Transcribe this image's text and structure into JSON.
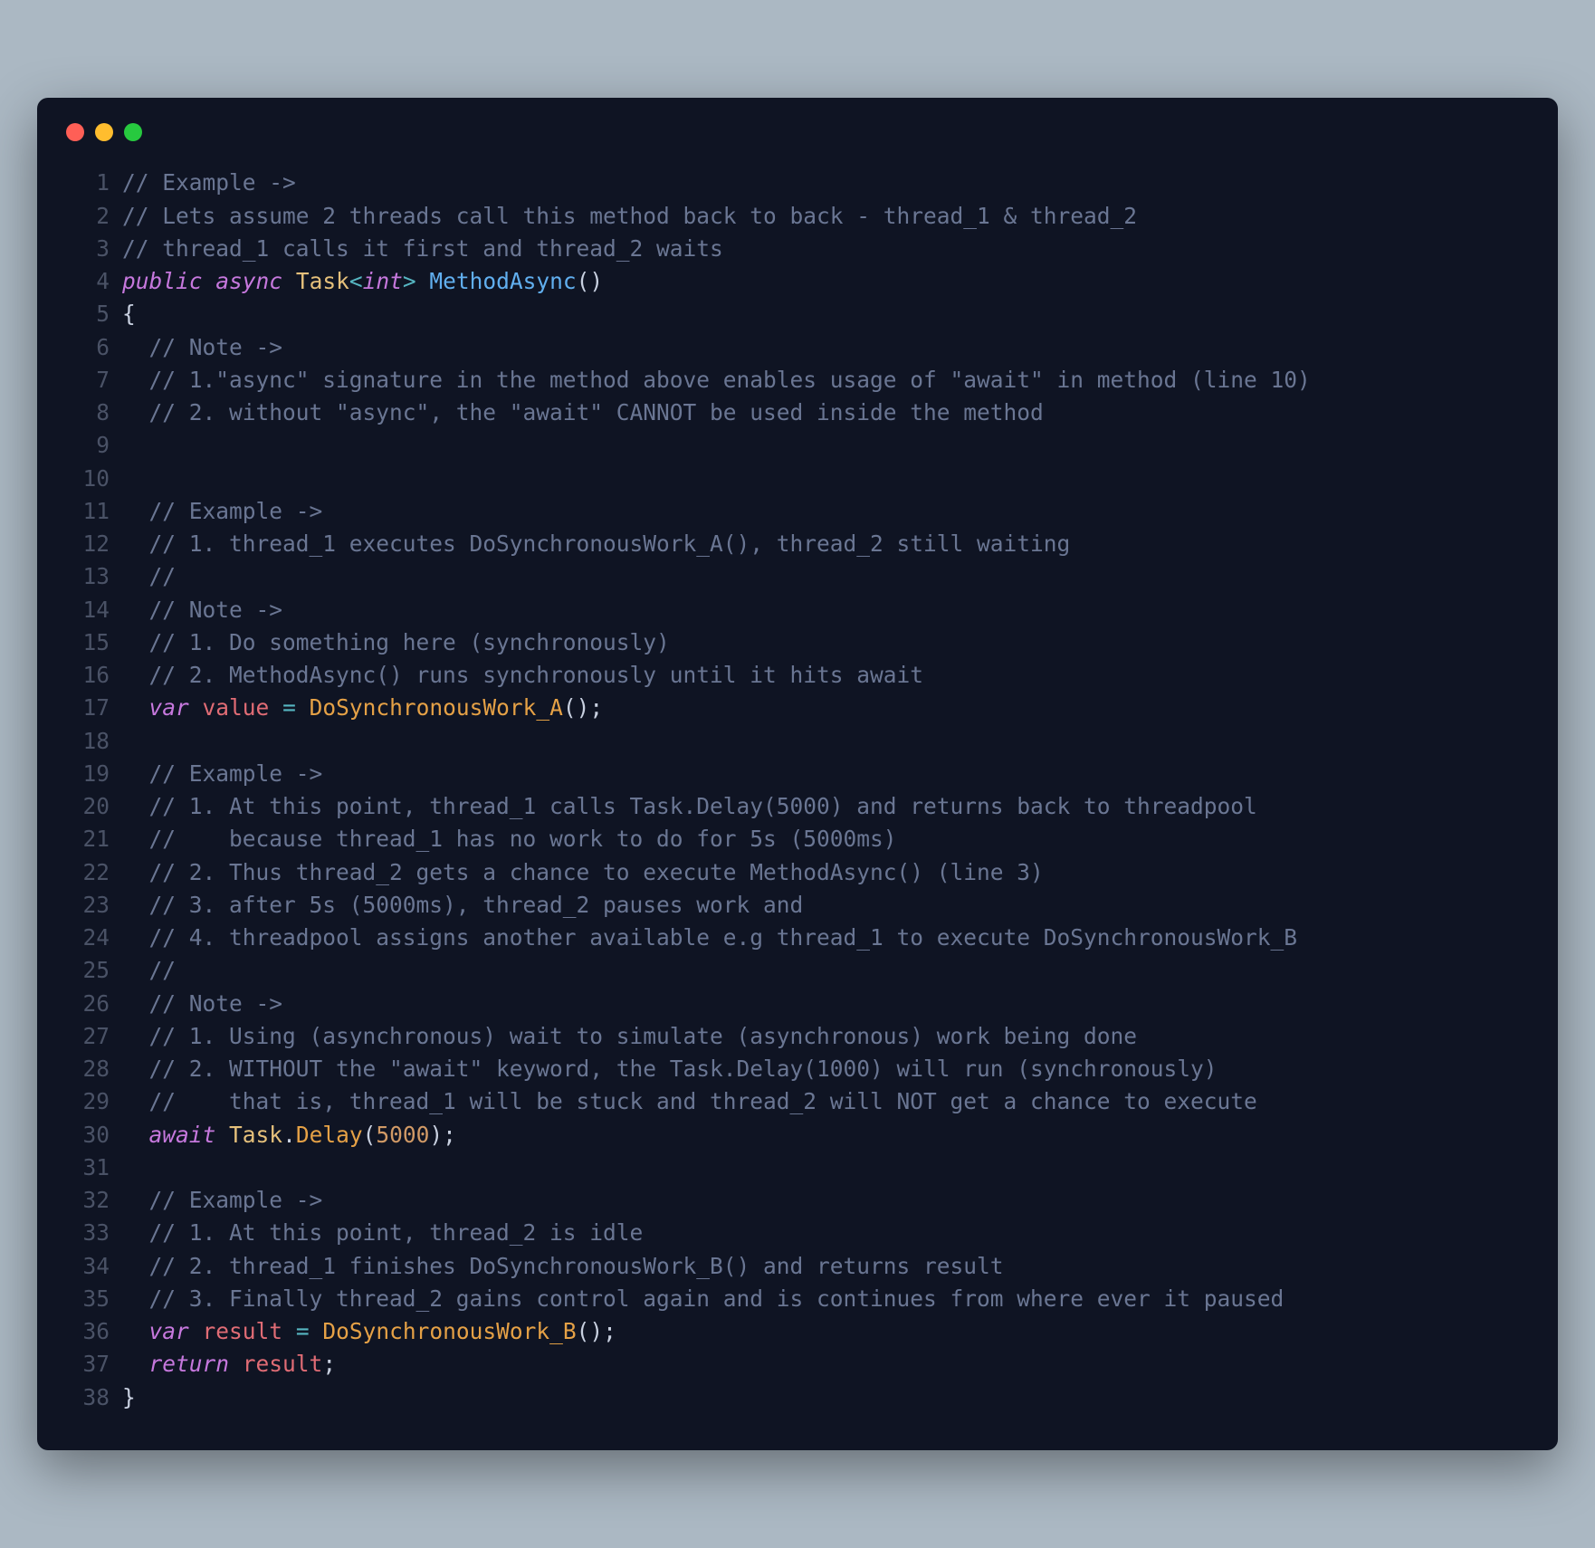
{
  "window": {
    "traffic_lights": {
      "red": "#ff5f56",
      "yellow": "#ffbd2e",
      "green": "#27c93f"
    }
  },
  "code": {
    "lines": [
      {
        "n": "1",
        "tokens": [
          [
            "comment",
            "// Example ->"
          ]
        ]
      },
      {
        "n": "2",
        "tokens": [
          [
            "comment",
            "// Lets assume 2 threads call this method back to back - thread_1 & thread_2"
          ]
        ]
      },
      {
        "n": "3",
        "tokens": [
          [
            "comment",
            "// thread_1 calls it first and thread_2 waits"
          ]
        ]
      },
      {
        "n": "4",
        "tokens": [
          [
            "keyword",
            "public"
          ],
          [
            "plain",
            " "
          ],
          [
            "keyword",
            "async"
          ],
          [
            "plain",
            " "
          ],
          [
            "class",
            "Task"
          ],
          [
            "op",
            "<"
          ],
          [
            "keyword2",
            "int"
          ],
          [
            "op",
            ">"
          ],
          [
            "plain",
            " "
          ],
          [
            "method",
            "MethodAsync"
          ],
          [
            "punct",
            "("
          ],
          [
            "punct",
            ")"
          ]
        ]
      },
      {
        "n": "5",
        "tokens": [
          [
            "brace",
            "{"
          ]
        ]
      },
      {
        "n": "6",
        "tokens": [
          [
            "plain",
            "  "
          ],
          [
            "comment",
            "// Note ->"
          ]
        ]
      },
      {
        "n": "7",
        "tokens": [
          [
            "plain",
            "  "
          ],
          [
            "comment",
            "// 1.\"async\" signature in the method above enables usage of \"await\" in method (line 10)"
          ]
        ]
      },
      {
        "n": "8",
        "tokens": [
          [
            "plain",
            "  "
          ],
          [
            "comment",
            "// 2. without \"async\", the \"await\" CANNOT be used inside the method"
          ]
        ]
      },
      {
        "n": "9",
        "tokens": []
      },
      {
        "n": "10",
        "tokens": []
      },
      {
        "n": "11",
        "tokens": [
          [
            "plain",
            "  "
          ],
          [
            "comment",
            "// Example ->"
          ]
        ]
      },
      {
        "n": "12",
        "tokens": [
          [
            "plain",
            "  "
          ],
          [
            "comment",
            "// 1. thread_1 executes DoSynchronousWork_A(), thread_2 still waiting"
          ]
        ]
      },
      {
        "n": "13",
        "tokens": [
          [
            "plain",
            "  "
          ],
          [
            "comment",
            "//"
          ]
        ]
      },
      {
        "n": "14",
        "tokens": [
          [
            "plain",
            "  "
          ],
          [
            "comment",
            "// Note ->"
          ]
        ]
      },
      {
        "n": "15",
        "tokens": [
          [
            "plain",
            "  "
          ],
          [
            "comment",
            "// 1. Do something here (synchronously)"
          ]
        ]
      },
      {
        "n": "16",
        "tokens": [
          [
            "plain",
            "  "
          ],
          [
            "comment",
            "// 2. MethodAsync() runs synchronously until it hits await"
          ]
        ]
      },
      {
        "n": "17",
        "tokens": [
          [
            "plain",
            "  "
          ],
          [
            "var",
            "var"
          ],
          [
            "plain",
            " "
          ],
          [
            "ident",
            "value"
          ],
          [
            "plain",
            " "
          ],
          [
            "op",
            "="
          ],
          [
            "plain",
            " "
          ],
          [
            "call",
            "DoSynchronousWork_A"
          ],
          [
            "punct",
            "("
          ],
          [
            "punct",
            ")"
          ],
          [
            "punct",
            ";"
          ]
        ]
      },
      {
        "n": "18",
        "tokens": []
      },
      {
        "n": "19",
        "tokens": [
          [
            "plain",
            "  "
          ],
          [
            "comment",
            "// Example ->"
          ]
        ]
      },
      {
        "n": "20",
        "tokens": [
          [
            "plain",
            "  "
          ],
          [
            "comment",
            "// 1. At this point, thread_1 calls Task.Delay(5000) and returns back to threadpool"
          ]
        ]
      },
      {
        "n": "21",
        "tokens": [
          [
            "plain",
            "  "
          ],
          [
            "comment",
            "//    because thread_1 has no work to do for 5s (5000ms)"
          ]
        ]
      },
      {
        "n": "22",
        "tokens": [
          [
            "plain",
            "  "
          ],
          [
            "comment",
            "// 2. Thus thread_2 gets a chance to execute MethodAsync() (line 3)"
          ]
        ]
      },
      {
        "n": "23",
        "tokens": [
          [
            "plain",
            "  "
          ],
          [
            "comment",
            "// 3. after 5s (5000ms), thread_2 pauses work and"
          ]
        ]
      },
      {
        "n": "24",
        "tokens": [
          [
            "plain",
            "  "
          ],
          [
            "comment",
            "// 4. threadpool assigns another available e.g thread_1 to execute DoSynchronousWork_B"
          ]
        ]
      },
      {
        "n": "25",
        "tokens": [
          [
            "plain",
            "  "
          ],
          [
            "comment",
            "//"
          ]
        ]
      },
      {
        "n": "26",
        "tokens": [
          [
            "plain",
            "  "
          ],
          [
            "comment",
            "// Note ->"
          ]
        ]
      },
      {
        "n": "27",
        "tokens": [
          [
            "plain",
            "  "
          ],
          [
            "comment",
            "// 1. Using (asynchronous) wait to simulate (asynchronous) work being done"
          ]
        ]
      },
      {
        "n": "28",
        "tokens": [
          [
            "plain",
            "  "
          ],
          [
            "comment",
            "// 2. WITHOUT the \"await\" keyword, the Task.Delay(1000) will run (synchronously)"
          ]
        ]
      },
      {
        "n": "29",
        "tokens": [
          [
            "plain",
            "  "
          ],
          [
            "comment",
            "//    that is, thread_1 will be stuck and thread_2 will NOT get a chance to execute"
          ]
        ]
      },
      {
        "n": "30",
        "tokens": [
          [
            "plain",
            "  "
          ],
          [
            "await",
            "await"
          ],
          [
            "plain",
            " "
          ],
          [
            "prop",
            "Task"
          ],
          [
            "dot",
            "."
          ],
          [
            "call",
            "Delay"
          ],
          [
            "punct",
            "("
          ],
          [
            "num",
            "5000"
          ],
          [
            "punct",
            ")"
          ],
          [
            "punct",
            ";"
          ]
        ]
      },
      {
        "n": "31",
        "tokens": []
      },
      {
        "n": "32",
        "tokens": [
          [
            "plain",
            "  "
          ],
          [
            "comment",
            "// Example -> "
          ]
        ]
      },
      {
        "n": "33",
        "tokens": [
          [
            "plain",
            "  "
          ],
          [
            "comment",
            "// 1. At this point, thread_2 is idle"
          ]
        ]
      },
      {
        "n": "34",
        "tokens": [
          [
            "plain",
            "  "
          ],
          [
            "comment",
            "// 2. thread_1 finishes DoSynchronousWork_B() and returns result"
          ]
        ]
      },
      {
        "n": "35",
        "tokens": [
          [
            "plain",
            "  "
          ],
          [
            "comment",
            "// 3. Finally thread_2 gains control again and is continues from where ever it paused"
          ]
        ]
      },
      {
        "n": "36",
        "tokens": [
          [
            "plain",
            "  "
          ],
          [
            "var",
            "var"
          ],
          [
            "plain",
            " "
          ],
          [
            "ident",
            "result"
          ],
          [
            "plain",
            " "
          ],
          [
            "op",
            "="
          ],
          [
            "plain",
            " "
          ],
          [
            "call",
            "DoSynchronousWork_B"
          ],
          [
            "punct",
            "("
          ],
          [
            "punct",
            ")"
          ],
          [
            "punct",
            ";"
          ]
        ]
      },
      {
        "n": "37",
        "tokens": [
          [
            "plain",
            "  "
          ],
          [
            "return",
            "return"
          ],
          [
            "plain",
            " "
          ],
          [
            "ident",
            "result"
          ],
          [
            "punct",
            ";"
          ]
        ]
      },
      {
        "n": "38",
        "tokens": [
          [
            "brace",
            "}"
          ]
        ]
      }
    ]
  }
}
